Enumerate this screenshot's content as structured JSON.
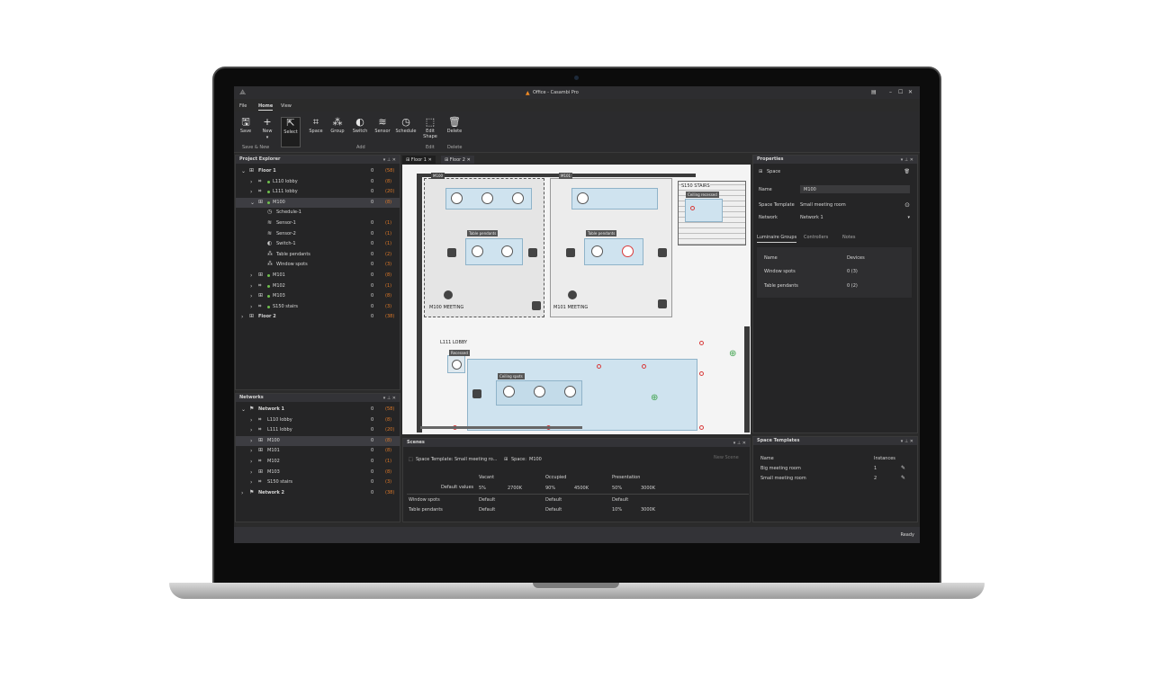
{
  "window": {
    "title": "Office - Casambi Pro",
    "status": "Ready"
  },
  "menu": [
    "File",
    "Home",
    "View"
  ],
  "toolbar": {
    "buttons": [
      {
        "label": "Save",
        "icon": "save-icon"
      },
      {
        "label": "New",
        "icon": "plus-icon"
      },
      {
        "label": "Select",
        "icon": "cursor-icon"
      },
      {
        "label": "Space",
        "icon": "space-icon"
      },
      {
        "label": "Group",
        "icon": "group-icon"
      },
      {
        "label": "Switch",
        "icon": "switch-icon"
      },
      {
        "label": "Sensor",
        "icon": "sensor-icon"
      },
      {
        "label": "Schedule",
        "icon": "schedule-icon"
      },
      {
        "label": "Edit",
        "label2": "Shape",
        "icon": "edit-shape-icon"
      },
      {
        "label": "Delete",
        "icon": "trash-icon"
      }
    ],
    "groups": [
      "Save & New",
      "Add",
      "Edit",
      "Delete"
    ]
  },
  "project_explorer": {
    "title": "Project Explorer",
    "items": [
      {
        "label": "Floor 1",
        "a": "0",
        "b": "(58)"
      },
      {
        "label": "L110 lobby",
        "a": "0",
        "b": "(8)"
      },
      {
        "label": "L111 lobby",
        "a": "0",
        "b": "(20)"
      },
      {
        "label": "M100",
        "a": "0",
        "b": "(8)"
      },
      {
        "label": "Schedule-1",
        "a": "",
        "b": ""
      },
      {
        "label": "Sensor-1",
        "a": "0",
        "b": "(1)"
      },
      {
        "label": "Sensor-2",
        "a": "0",
        "b": "(1)"
      },
      {
        "label": "Switch-1",
        "a": "0",
        "b": "(1)"
      },
      {
        "label": "Table pendants",
        "a": "0",
        "b": "(2)"
      },
      {
        "label": "Window spots",
        "a": "0",
        "b": "(3)"
      },
      {
        "label": "M101",
        "a": "0",
        "b": "(8)"
      },
      {
        "label": "M102",
        "a": "0",
        "b": "(1)"
      },
      {
        "label": "M103",
        "a": "0",
        "b": "(8)"
      },
      {
        "label": "S150 stairs",
        "a": "0",
        "b": "(3)"
      },
      {
        "label": "Floor 2",
        "a": "0",
        "b": "(38)"
      }
    ]
  },
  "networks": {
    "title": "Networks",
    "items": [
      {
        "label": "Network 1",
        "a": "0",
        "b": "(58)"
      },
      {
        "label": "L110 lobby",
        "a": "0",
        "b": "(8)"
      },
      {
        "label": "L111 lobby",
        "a": "0",
        "b": "(20)"
      },
      {
        "label": "M100",
        "a": "0",
        "b": "(8)"
      },
      {
        "label": "M101",
        "a": "0",
        "b": "(8)"
      },
      {
        "label": "M102",
        "a": "0",
        "b": "(1)"
      },
      {
        "label": "M103",
        "a": "0",
        "b": "(8)"
      },
      {
        "label": "S150 stairs",
        "a": "0",
        "b": "(3)"
      },
      {
        "label": "Network 2",
        "a": "0",
        "b": "(38)"
      }
    ]
  },
  "doc_tabs": [
    "Floor 1",
    "Floor 2"
  ],
  "plan": {
    "rooms": [
      "M100",
      "M101",
      "S150 STAIRS",
      "L111 LOBBY"
    ],
    "meeting_labels": [
      "M100 MEETING",
      "M101 MEETING"
    ],
    "tags": [
      "Table pendants",
      "Table pendants",
      "Ceiling recessed",
      "Recessed",
      "Ceiling spots"
    ]
  },
  "properties": {
    "title": "Properties",
    "section": "Space",
    "fields": [
      {
        "label": "Name",
        "value": "M100"
      },
      {
        "label": "Space Template",
        "value": "Small meeting room"
      },
      {
        "label": "Network",
        "value": "Network 1"
      }
    ],
    "tabs": [
      "Luminaire Groups",
      "Controllers",
      "Notes"
    ],
    "table_headers": [
      "Name",
      "Devices"
    ],
    "rows": [
      {
        "name": "Window spots",
        "devices": "0  (3)"
      },
      {
        "name": "Table pendants",
        "devices": "0  (2)"
      }
    ]
  },
  "scenes": {
    "title": "Scenes",
    "template_label": "Space Template:",
    "template_value": "Small meeting ro...",
    "space_label": "Space:",
    "space_value": "M100",
    "new_scene": "New Scene",
    "columns": [
      "Vacant",
      "Occupied",
      "Presentation"
    ],
    "default_label": "Default values",
    "default_values": [
      "5%",
      "2700K",
      "90%",
      "4500K",
      "50%",
      "3000K"
    ],
    "rows": [
      {
        "name": "Window spots",
        "c1": "Default",
        "c2": "Default",
        "c3": "Default",
        "c4": ""
      },
      {
        "name": "Table pendants",
        "c1": "Default",
        "c2": "Default",
        "c3": "10%",
        "c4": "3000K"
      }
    ]
  },
  "space_templates": {
    "title": "Space Templates",
    "headers": [
      "Name",
      "Instances"
    ],
    "rows": [
      {
        "name": "Big meeting room",
        "count": "1"
      },
      {
        "name": "Small meeting room",
        "count": "2"
      }
    ]
  }
}
